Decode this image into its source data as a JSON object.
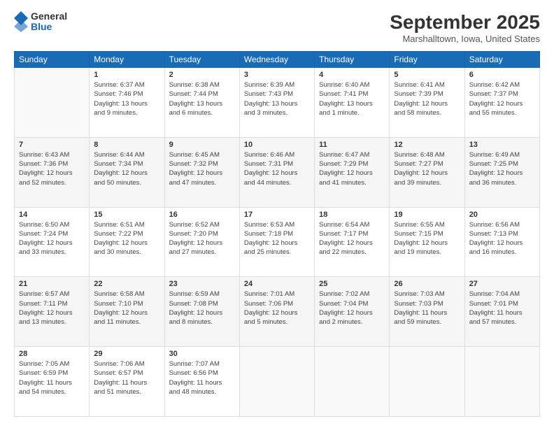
{
  "header": {
    "logo": {
      "line1": "General",
      "line2": "Blue"
    },
    "title": "September 2025",
    "location": "Marshalltown, Iowa, United States"
  },
  "calendar": {
    "days_of_week": [
      "Sunday",
      "Monday",
      "Tuesday",
      "Wednesday",
      "Thursday",
      "Friday",
      "Saturday"
    ],
    "weeks": [
      [
        {
          "day": "",
          "info": ""
        },
        {
          "day": "1",
          "info": "Sunrise: 6:37 AM\nSunset: 7:46 PM\nDaylight: 13 hours\nand 9 minutes."
        },
        {
          "day": "2",
          "info": "Sunrise: 6:38 AM\nSunset: 7:44 PM\nDaylight: 13 hours\nand 6 minutes."
        },
        {
          "day": "3",
          "info": "Sunrise: 6:39 AM\nSunset: 7:43 PM\nDaylight: 13 hours\nand 3 minutes."
        },
        {
          "day": "4",
          "info": "Sunrise: 6:40 AM\nSunset: 7:41 PM\nDaylight: 13 hours\nand 1 minute."
        },
        {
          "day": "5",
          "info": "Sunrise: 6:41 AM\nSunset: 7:39 PM\nDaylight: 12 hours\nand 58 minutes."
        },
        {
          "day": "6",
          "info": "Sunrise: 6:42 AM\nSunset: 7:37 PM\nDaylight: 12 hours\nand 55 minutes."
        }
      ],
      [
        {
          "day": "7",
          "info": "Sunrise: 6:43 AM\nSunset: 7:36 PM\nDaylight: 12 hours\nand 52 minutes."
        },
        {
          "day": "8",
          "info": "Sunrise: 6:44 AM\nSunset: 7:34 PM\nDaylight: 12 hours\nand 50 minutes."
        },
        {
          "day": "9",
          "info": "Sunrise: 6:45 AM\nSunset: 7:32 PM\nDaylight: 12 hours\nand 47 minutes."
        },
        {
          "day": "10",
          "info": "Sunrise: 6:46 AM\nSunset: 7:31 PM\nDaylight: 12 hours\nand 44 minutes."
        },
        {
          "day": "11",
          "info": "Sunrise: 6:47 AM\nSunset: 7:29 PM\nDaylight: 12 hours\nand 41 minutes."
        },
        {
          "day": "12",
          "info": "Sunrise: 6:48 AM\nSunset: 7:27 PM\nDaylight: 12 hours\nand 39 minutes."
        },
        {
          "day": "13",
          "info": "Sunrise: 6:49 AM\nSunset: 7:25 PM\nDaylight: 12 hours\nand 36 minutes."
        }
      ],
      [
        {
          "day": "14",
          "info": "Sunrise: 6:50 AM\nSunset: 7:24 PM\nDaylight: 12 hours\nand 33 minutes."
        },
        {
          "day": "15",
          "info": "Sunrise: 6:51 AM\nSunset: 7:22 PM\nDaylight: 12 hours\nand 30 minutes."
        },
        {
          "day": "16",
          "info": "Sunrise: 6:52 AM\nSunset: 7:20 PM\nDaylight: 12 hours\nand 27 minutes."
        },
        {
          "day": "17",
          "info": "Sunrise: 6:53 AM\nSunset: 7:18 PM\nDaylight: 12 hours\nand 25 minutes."
        },
        {
          "day": "18",
          "info": "Sunrise: 6:54 AM\nSunset: 7:17 PM\nDaylight: 12 hours\nand 22 minutes."
        },
        {
          "day": "19",
          "info": "Sunrise: 6:55 AM\nSunset: 7:15 PM\nDaylight: 12 hours\nand 19 minutes."
        },
        {
          "day": "20",
          "info": "Sunrise: 6:56 AM\nSunset: 7:13 PM\nDaylight: 12 hours\nand 16 minutes."
        }
      ],
      [
        {
          "day": "21",
          "info": "Sunrise: 6:57 AM\nSunset: 7:11 PM\nDaylight: 12 hours\nand 13 minutes."
        },
        {
          "day": "22",
          "info": "Sunrise: 6:58 AM\nSunset: 7:10 PM\nDaylight: 12 hours\nand 11 minutes."
        },
        {
          "day": "23",
          "info": "Sunrise: 6:59 AM\nSunset: 7:08 PM\nDaylight: 12 hours\nand 8 minutes."
        },
        {
          "day": "24",
          "info": "Sunrise: 7:01 AM\nSunset: 7:06 PM\nDaylight: 12 hours\nand 5 minutes."
        },
        {
          "day": "25",
          "info": "Sunrise: 7:02 AM\nSunset: 7:04 PM\nDaylight: 12 hours\nand 2 minutes."
        },
        {
          "day": "26",
          "info": "Sunrise: 7:03 AM\nSunset: 7:03 PM\nDaylight: 11 hours\nand 59 minutes."
        },
        {
          "day": "27",
          "info": "Sunrise: 7:04 AM\nSunset: 7:01 PM\nDaylight: 11 hours\nand 57 minutes."
        }
      ],
      [
        {
          "day": "28",
          "info": "Sunrise: 7:05 AM\nSunset: 6:59 PM\nDaylight: 11 hours\nand 54 minutes."
        },
        {
          "day": "29",
          "info": "Sunrise: 7:06 AM\nSunset: 6:57 PM\nDaylight: 11 hours\nand 51 minutes."
        },
        {
          "day": "30",
          "info": "Sunrise: 7:07 AM\nSunset: 6:56 PM\nDaylight: 11 hours\nand 48 minutes."
        },
        {
          "day": "",
          "info": ""
        },
        {
          "day": "",
          "info": ""
        },
        {
          "day": "",
          "info": ""
        },
        {
          "day": "",
          "info": ""
        }
      ]
    ]
  }
}
